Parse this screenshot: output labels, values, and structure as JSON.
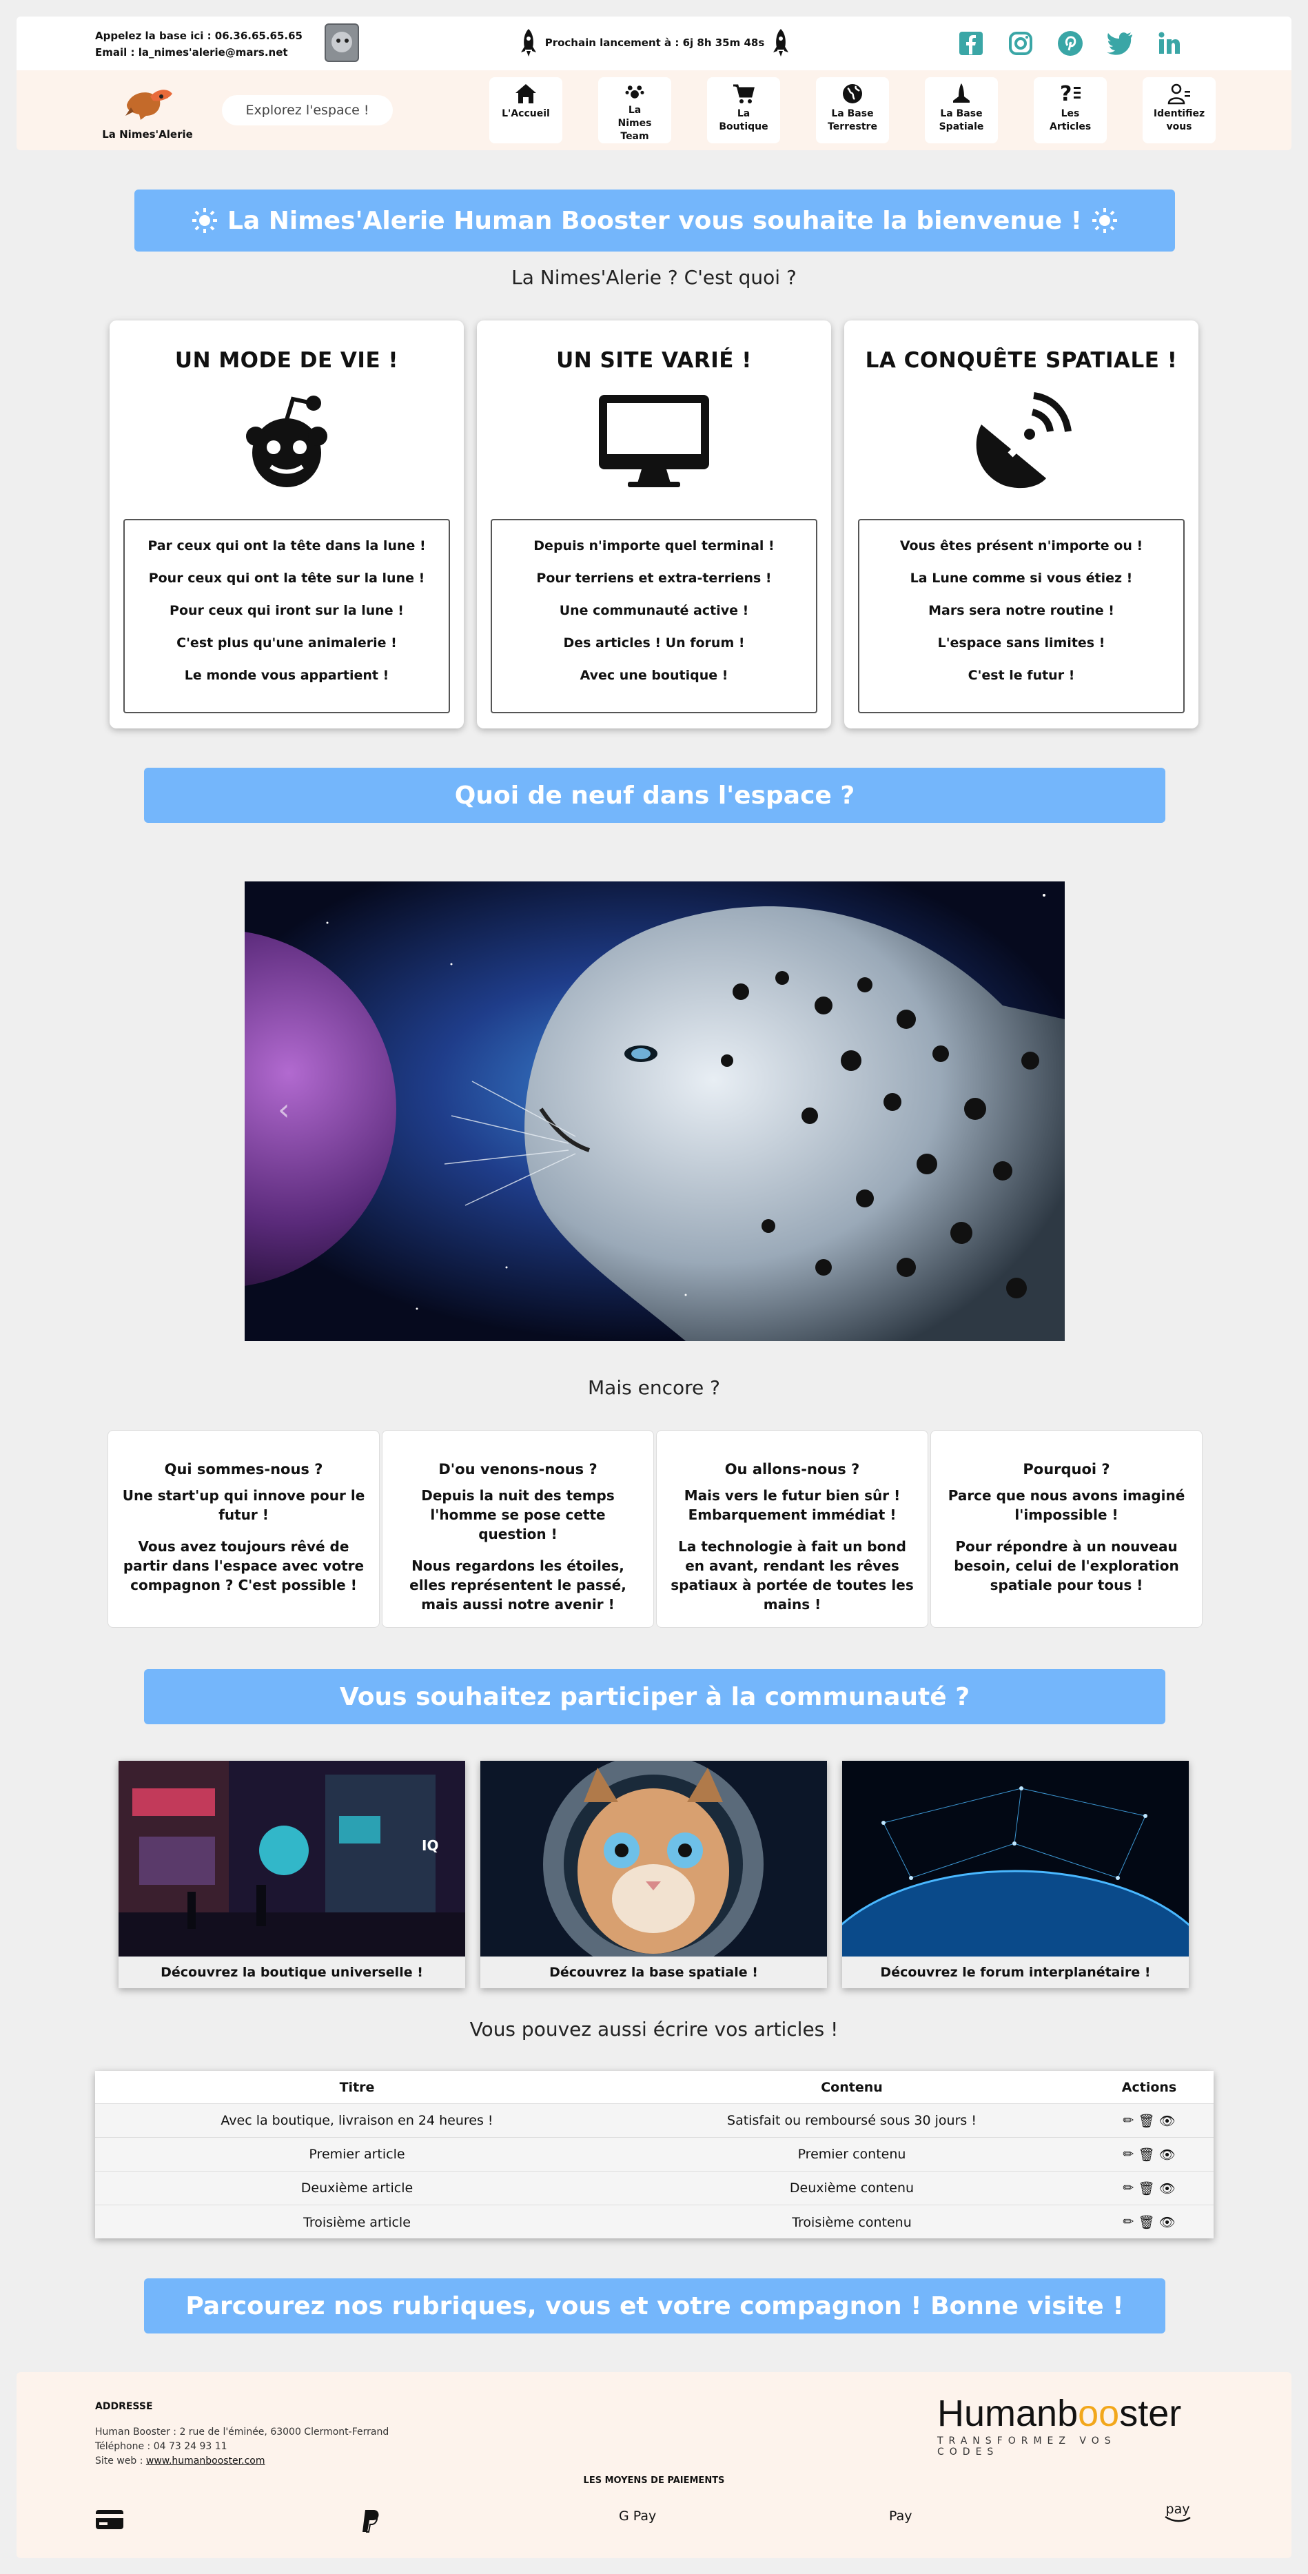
{
  "header": {
    "contact_phone": "Appelez la base ici : 06.36.65.65.65",
    "contact_email": "Email : la_nimes'alerie@mars.net",
    "launch_text": "Prochain lancement à : 6j 8h 35m 48s",
    "social": [
      "facebook-icon",
      "instagram-icon",
      "pinterest-icon",
      "twitter-icon",
      "linkedin-icon"
    ],
    "logo_text": "La Nimes'Alerie",
    "explore_label": "Explorez l'espace !",
    "nav": [
      {
        "label": "L'Accueil",
        "icon": "home-icon"
      },
      {
        "label": "La Nimes Team",
        "icon": "team-icon"
      },
      {
        "label": "La Boutique",
        "icon": "cart-icon"
      },
      {
        "label": "La Base Terrestre",
        "icon": "globe-icon"
      },
      {
        "label": "La Base Spatiale",
        "icon": "shuttle-icon"
      },
      {
        "label": "Les Articles",
        "icon": "articles-icon"
      },
      {
        "label": "Identifiez vous",
        "icon": "user-icon"
      }
    ]
  },
  "welcome_banner": "La Nimes'Alerie Human Booster vous souhaite la bienvenue !",
  "what_is": "La Nimes'Alerie ? C'est quoi ?",
  "cards": [
    {
      "title": "UN MODE DE VIE !",
      "icon": "reddit-icon",
      "lines": [
        "Par ceux qui ont la tête dans la lune !",
        "Pour ceux qui ont la tête sur la lune !",
        "Pour ceux qui iront sur la lune !",
        "C'est plus qu'une animalerie !",
        "Le monde vous appartient !"
      ]
    },
    {
      "title": "UN SITE VARIÉ !",
      "icon": "desktop-icon",
      "lines": [
        "Depuis n'importe quel terminal !",
        "Pour terriens et extra-terriens !",
        "Une communauté active !",
        "Des articles ! Un forum !",
        "Avec une boutique !"
      ]
    },
    {
      "title": "LA CONQUÊTE SPATIALE !",
      "icon": "satellite-dish-icon",
      "lines": [
        "Vous êtes présent n'importe ou !",
        "La Lune comme si vous étiez !",
        "Mars sera notre routine !",
        "L'espace sans limites !",
        "C'est le futur !"
      ]
    }
  ],
  "news_banner": "Quoi de neuf dans l'espace ?",
  "more_title": "Mais encore ?",
  "info": [
    {
      "title": "Qui sommes-nous ?",
      "p1": "Une start'up qui innove pour le futur !",
      "p2": "Vous avez toujours rêvé de partir dans l'espace avec votre compagnon ? C'est possible !"
    },
    {
      "title": "D'ou venons-nous ?",
      "p1": "Depuis la nuit des temps l'homme se pose cette question !",
      "p2": "Nous regardons les étoiles, elles représentent le passé, mais aussi notre avenir !"
    },
    {
      "title": "Ou allons-nous ?",
      "p1": "Mais vers le futur bien sûr ! Embarquement immédiat !",
      "p2": "La technologie à fait un bond en avant, rendant les rêves spatiaux à portée de toutes les mains !"
    },
    {
      "title": "Pourquoi ?",
      "p1": "Parce que nous avons imaginé l'impossible !",
      "p2": "Pour répondre à un nouveau besoin, celui de l'exploration spatiale pour tous !"
    }
  ],
  "community_banner": "Vous souhaitez participer à la communauté ?",
  "thumbs": [
    "Découvrez la boutique universelle !",
    "Découvrez la base spatiale !",
    "Découvrez le forum interplanétaire !"
  ],
  "articles_title": "Vous pouvez aussi écrire vos articles !",
  "table": {
    "headers": [
      "Titre",
      "Contenu",
      "Actions"
    ],
    "rows": [
      [
        "Avec la boutique, livraison en 24 heures !",
        "Satisfait ou remboursé sous 30 jours !"
      ],
      [
        "Premier article",
        "Premier contenu"
      ],
      [
        "Deuxième article",
        "Deuxième contenu"
      ],
      [
        "Troisième article",
        "Troisième contenu"
      ]
    ]
  },
  "bottom_banner": "Parcourez nos rubriques, vous et votre compagnon ! Bonne visite !",
  "footer": {
    "addr_title": "ADDRESSE",
    "addr_line": "Human Booster : 2 rue de l'éminée, 63000 Clermont-Ferrand",
    "phone": "Téléphone : 04 73 24 93 11",
    "web_label": "Site web : ",
    "web_link": "www.humanbooster.com",
    "brand_a": "Humanb",
    "brand_b": "oo",
    "brand_c": "ster",
    "brand_tagline": "TRANSFORMEZ VOS CODES",
    "pay_title": "LES MOYENS DE PAIEMENTS",
    "payments": [
      "credit-card-icon",
      "paypal-icon",
      "G Pay",
      " Pay",
      "pay"
    ]
  }
}
